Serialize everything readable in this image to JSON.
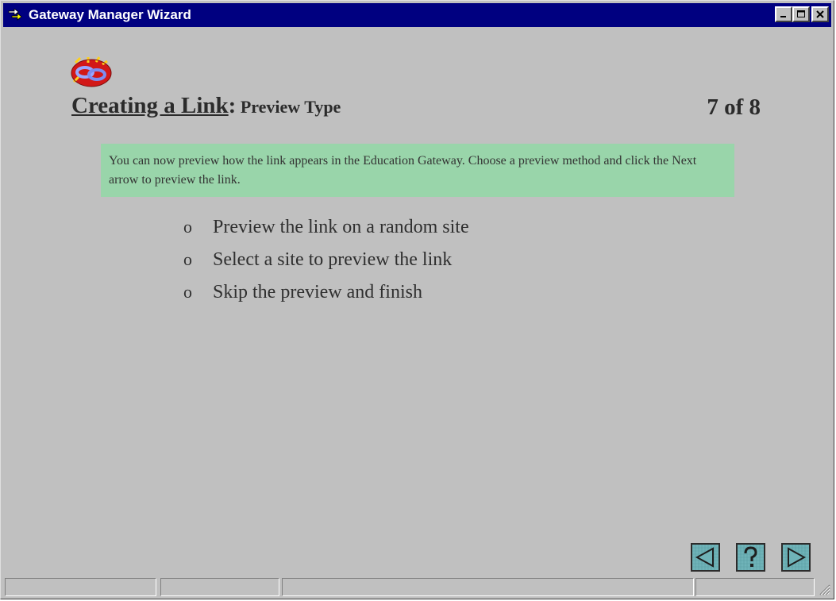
{
  "window": {
    "title": "Gateway Manager Wizard"
  },
  "heading": {
    "main": "Creating a Link",
    "colon": ":",
    "sub": " Preview Type",
    "counter": "7 of 8"
  },
  "info": "You can now preview how the link appears in the Education Gateway. Choose a preview method and click the Next arrow to preview the link.",
  "options": [
    {
      "bullet": "o",
      "label": "Preview the link on a random site"
    },
    {
      "bullet": "o",
      "label": "Select a site to preview the link"
    },
    {
      "bullet": "o",
      "label": "Skip the preview and finish"
    }
  ],
  "nav": {
    "back_icon": "left-arrow-icon",
    "help_icon": "question-mark-icon",
    "next_icon": "right-arrow-icon"
  },
  "colors": {
    "titlebar": "#000080",
    "window_bg": "#c0c0c0",
    "info_bg": "#99d5aa",
    "nav_button": "#6fb3b8"
  }
}
